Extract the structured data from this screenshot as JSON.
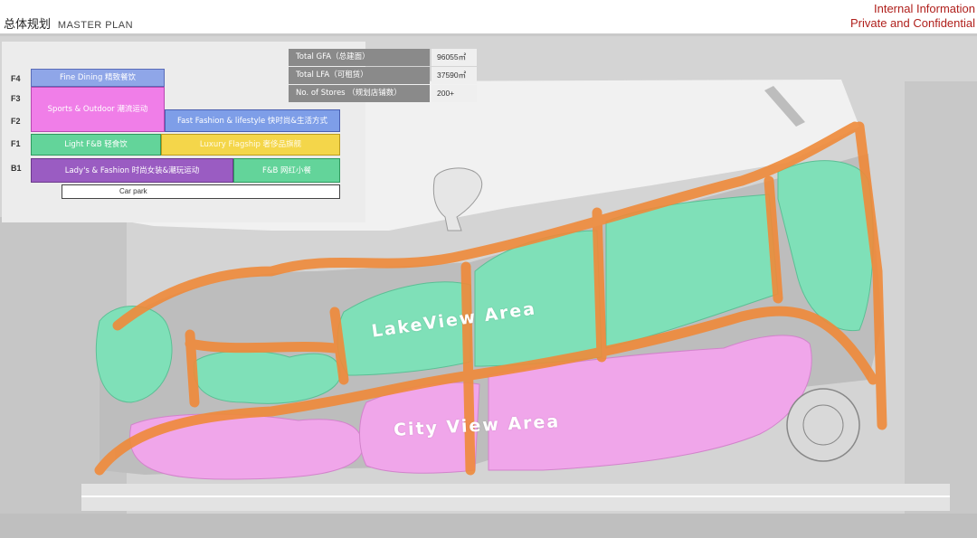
{
  "header": {
    "title_cn": "总体规划",
    "title_en": "MASTER PLAN",
    "confidential_line1": "Internal Information",
    "confidential_line2": "Private and Confidential"
  },
  "stats": [
    {
      "label": "Total GFA（总建面）",
      "value": "96055㎡"
    },
    {
      "label": "Total LFA（可租赁）",
      "value": "37590㎡"
    },
    {
      "label": "No. of Stores （规划店铺数）",
      "value": "200+"
    }
  ],
  "floors": [
    "F4",
    "F3",
    "F2",
    "F1",
    "B1"
  ],
  "zones": {
    "fine_dining": "Fine Dining 精致餐饮",
    "sports_outdoor": "Sports & Outdoor 潮流运动",
    "fast_fashion": "Fast Fashion & lifestyle 快时尚&生活方式",
    "light_fb": "Light F&B 轻食饮",
    "luxury": "Luxury Flagship 奢侈品旗舰",
    "ladys_fashion": "Lady's & Fashion 时尚女装&潮玩运动",
    "fb_street": "F&B 网红小餐",
    "carpark": "Car park"
  },
  "areas": {
    "lakeview": "LakeView Area",
    "cityview": "City View Area"
  },
  "colors": {
    "lakeview_fill": "#7fe0b8",
    "cityview_fill": "#f0a6ea",
    "path": "#ef8a3a",
    "lake": "#f2f2f2",
    "site": "#d8d8d8",
    "confidential": "#b0201c"
  }
}
